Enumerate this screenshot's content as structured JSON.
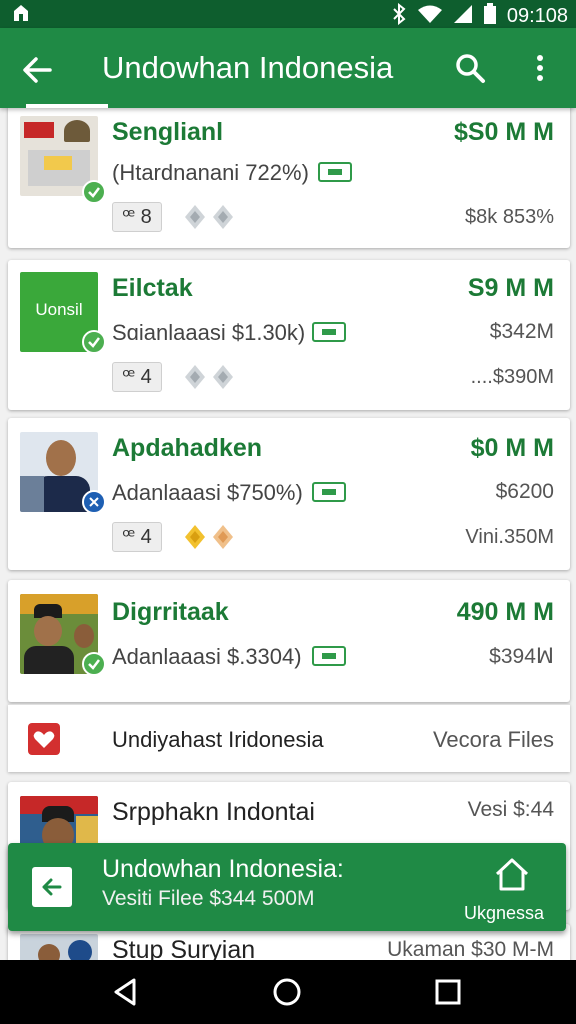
{
  "status_bar": {
    "time": "09:108"
  },
  "app_bar": {
    "title": "Undowhan Indonesia"
  },
  "cards": [
    {
      "name": "Senglianl",
      "price": "$S0 M M",
      "subtitle": "(Htardnanani 722%)",
      "amount": "",
      "rank": "ꟹ 8",
      "meta": "$8k 853%"
    },
    {
      "name": "Eilctak",
      "price": "S9 M M",
      "subtitle": "Sɑianlaaasi $1.30k)",
      "amount": "$342M",
      "rank": "ꟹ 4",
      "meta": "....$390M",
      "thumb_text": "Uonsil"
    },
    {
      "name": "Apdahadken",
      "price": "$0 M M",
      "subtitle": "Adanlaaasi $750%)",
      "amount": "$6200",
      "rank": "ꟹ 4",
      "meta": "Vini.350M"
    },
    {
      "name": "Digrritaak",
      "price": "490 M M",
      "subtitle": "Adanlaaasi $.3304)",
      "amount": "$394ꟽ"
    }
  ],
  "link_row": {
    "label": "Undiyahast Iridonesia",
    "right": "Vecora Files"
  },
  "card5": {
    "name": "Srpphakn Indontai",
    "right": "Vesi $:44"
  },
  "card6": {
    "name": "Stup Suryian",
    "right": "Ukaman $30 M-M"
  },
  "snackbar": {
    "title": "Undowhan Indonesia:",
    "subtitle": "Vesiti Filee $344 500M",
    "action_label": "Ukgnessa"
  },
  "colors": {
    "primary": "#1f8a45",
    "primary_dark": "#0e5e2e",
    "accent_text": "#1c7a36",
    "check": "#4caf50",
    "heart": "#d32f2f"
  }
}
